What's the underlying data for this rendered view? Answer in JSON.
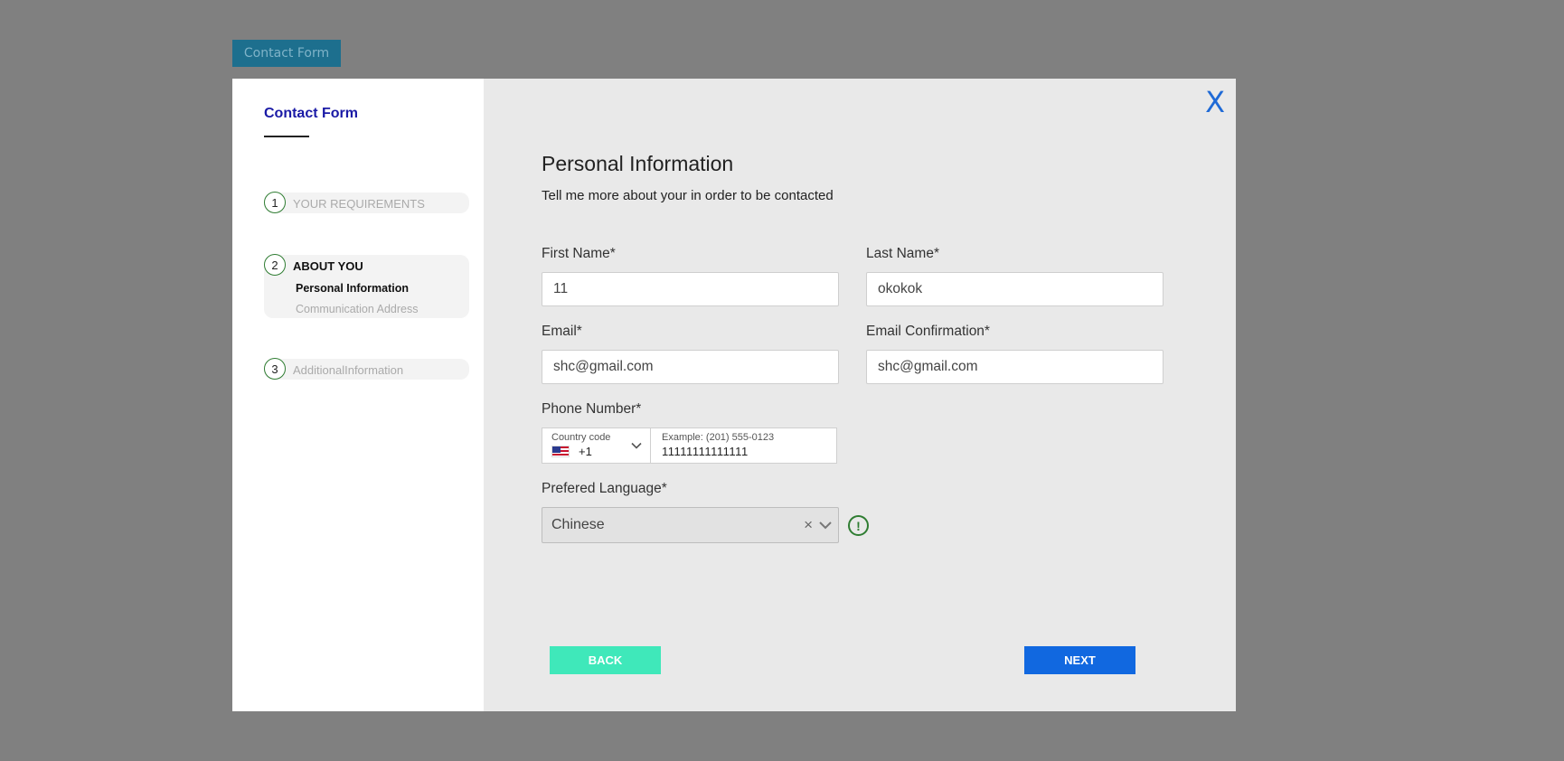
{
  "background_button": {
    "label": "Contact Form"
  },
  "sidebar": {
    "title": "Contact Form",
    "steps": [
      {
        "number": "1",
        "label": "YOUR REQUIREMENTS",
        "state": "inactive"
      },
      {
        "number": "2",
        "label": "ABOUT YOU",
        "state": "active",
        "sub_items": [
          {
            "label": "Personal Information",
            "state": "active"
          },
          {
            "label": "Communication Address",
            "state": "inactive"
          }
        ]
      },
      {
        "number": "3",
        "label": "AdditionalInformation",
        "state": "inactive"
      }
    ]
  },
  "main": {
    "close_label": "X",
    "title": "Personal Information",
    "subtitle": "Tell me more about your in order to be contacted",
    "fields": {
      "first_name": {
        "label": "First Name*",
        "value": "11"
      },
      "last_name": {
        "label": "Last Name*",
        "value": "okokok"
      },
      "email": {
        "label": "Email*",
        "value": "shc@gmail.com"
      },
      "email_confirm": {
        "label": "Email Confirmation*",
        "value": "shc@gmail.com"
      },
      "phone": {
        "label": "Phone Number*",
        "country_code_caption": "Country code",
        "country_code": "+1",
        "country_flag": "us-flag-icon",
        "number_caption": "Example: (201) 555-0123",
        "number": "11111111111111"
      },
      "language": {
        "label": "Prefered Language*",
        "value": "Chinese",
        "clear_label": "×"
      }
    },
    "warning_symbol": "!",
    "buttons": {
      "back": "BACK",
      "next": "NEXT"
    }
  },
  "colors": {
    "accent_blue": "#1168e0",
    "back_button": "#3fe8ba",
    "step_ring": "#2f7d32",
    "sidebar_title": "#1a1aa6"
  }
}
